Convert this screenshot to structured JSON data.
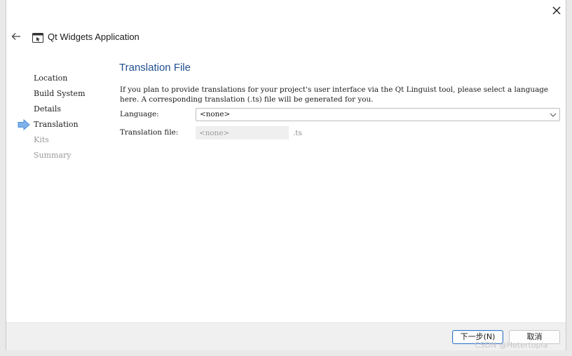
{
  "window": {
    "title": "Qt Widgets Application",
    "close_icon": "close-icon",
    "back_icon": "back-arrow-icon"
  },
  "steps": {
    "items": [
      {
        "label": "Location",
        "state": "done"
      },
      {
        "label": "Build System",
        "state": "done"
      },
      {
        "label": "Details",
        "state": "done"
      },
      {
        "label": "Translation",
        "state": "current"
      },
      {
        "label": "Kits",
        "state": "pending"
      },
      {
        "label": "Summary",
        "state": "pending"
      }
    ],
    "current_marker_color": "#4a90d9"
  },
  "page": {
    "title": "Translation File",
    "description": "If you plan to provide translations for your project's user interface via the Qt Linguist tool, please select a language here. A corresponding translation (.ts) file will be generated for you.",
    "language_label": "Language:",
    "language_value": "<none>",
    "translation_file_label": "Translation file:",
    "translation_file_placeholder": "<none>",
    "translation_file_ext": ".ts"
  },
  "footer": {
    "next_label": "下一步(N)",
    "cancel_label": "取消"
  },
  "watermark": "CSDN @Hetertopia",
  "colors": {
    "title_blue": "#1f4e8f",
    "primary_border": "#3b78c8",
    "footer_bg": "#f0f0f0"
  }
}
